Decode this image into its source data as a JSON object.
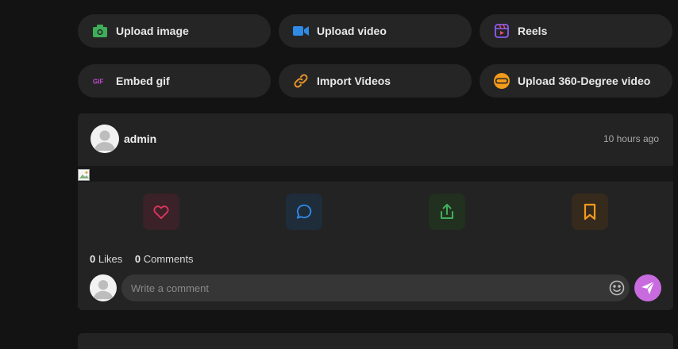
{
  "composer": {
    "buttons": [
      {
        "label": "Upload image",
        "icon": "camera-icon",
        "color": "#3fae5a"
      },
      {
        "label": "Upload video",
        "icon": "video-camera-icon",
        "color": "#2f8be6"
      },
      {
        "label": "Reels",
        "icon": "reels-icon",
        "color": "#8a5cf0"
      },
      {
        "label": "Embed gif",
        "icon": "gif-icon",
        "color": "#c94ad6"
      },
      {
        "label": "Import Videos",
        "icon": "link-icon",
        "color": "#e2932a"
      },
      {
        "label": "Upload 360-Degree video",
        "icon": "vr-headset-icon",
        "color": "#f29a1c"
      }
    ]
  },
  "post": {
    "username": "admin",
    "time": "10 hours ago",
    "actions": [
      {
        "name": "like",
        "icon": "heart-icon",
        "color": "#e0355f",
        "bg": "#3a2228"
      },
      {
        "name": "comment",
        "icon": "comment-bubble-icon",
        "color": "#2f8be6",
        "bg": "#1f2c3a"
      },
      {
        "name": "share",
        "icon": "share-icon",
        "color": "#3fae5a",
        "bg": "#22301f"
      },
      {
        "name": "save",
        "icon": "bookmark-icon",
        "color": "#f29a1c",
        "bg": "#362a1d"
      }
    ],
    "likes_count": "0",
    "likes_label": "Likes",
    "comments_count": "0",
    "comments_label": "Comments"
  },
  "comment_box": {
    "placeholder": "Write a comment",
    "emoji_icon": "smiley-icon",
    "send_icon": "send-icon",
    "send_color": "#c86bdf"
  }
}
